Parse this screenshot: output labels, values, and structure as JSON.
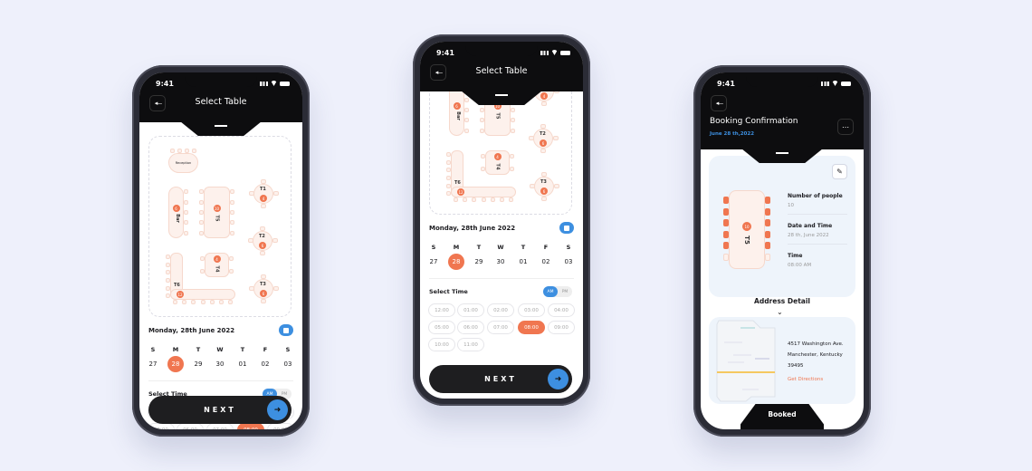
{
  "colors": {
    "accent": "#f07650",
    "blue": "#3d8fe0",
    "background": "#eef0fb"
  },
  "status_time": "9:41",
  "select_table": {
    "title": "Select Table",
    "back_icon": "arrow-left-icon",
    "floor_plan": {
      "reception": "Reception",
      "tables": [
        {
          "label": "Bar",
          "seats": "6"
        },
        {
          "label": "T5",
          "seats": "10"
        },
        {
          "label": "T1",
          "seats": "4"
        },
        {
          "label": "T2",
          "seats": "6"
        },
        {
          "label": "T4",
          "seats": "4"
        },
        {
          "label": "T6",
          "seats": "12"
        },
        {
          "label": "T3",
          "seats": "6"
        }
      ]
    },
    "date_label": "Monday, 28th June 2022",
    "calendar_icon": "calendar-icon",
    "weekdays": [
      "S",
      "M",
      "T",
      "W",
      "T",
      "F",
      "S"
    ],
    "days": [
      "27",
      "28",
      "29",
      "30",
      "01",
      "02",
      "03"
    ],
    "selected_day": "28",
    "select_time_label": "Select Time",
    "am": "AM",
    "pm": "PM",
    "selected_period": "AM",
    "times": [
      "12:00",
      "01:00",
      "02:00",
      "03:00",
      "04:00",
      "05:00",
      "06:00",
      "07:00",
      "08:00",
      "09:00",
      "10:00",
      "11:00"
    ],
    "selected_time": "08:00",
    "next_label": "NEXT"
  },
  "confirmation": {
    "title": "Booking Confirmation",
    "date": "June 28 th,2022",
    "table_label": "T5",
    "table_seats": "10",
    "fields": [
      {
        "label": "Number of people",
        "value": "10"
      },
      {
        "label": "Date and Time",
        "value": "28 th, June 2022"
      },
      {
        "label": "Time",
        "value": "08:00 AM"
      }
    ],
    "address_title": "Address Detail",
    "address_lines": [
      "4517 Washington Ave.",
      "Manchester, Kentucky",
      "39495"
    ],
    "directions": "Get Directions",
    "booked_label": "Booked"
  }
}
